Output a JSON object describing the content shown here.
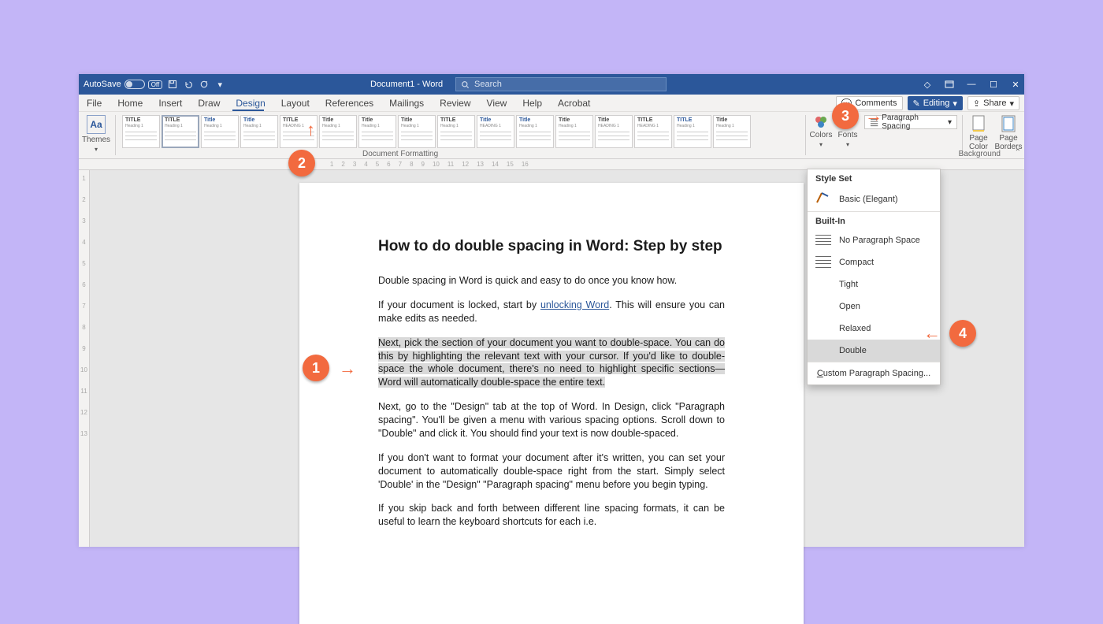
{
  "titlebar": {
    "autosave_label": "AutoSave",
    "autosave_state": "Off",
    "doc_title": "Document1 - Word",
    "search_placeholder": "Search"
  },
  "tabs": {
    "items": [
      "File",
      "Home",
      "Insert",
      "Draw",
      "Design",
      "Layout",
      "References",
      "Mailings",
      "Review",
      "View",
      "Help",
      "Acrobat"
    ],
    "active_index": 4,
    "right": {
      "comments": "Comments",
      "editing": "Editing",
      "share": "Share"
    }
  },
  "ribbon": {
    "themes": "Themes",
    "gallery_titles": [
      "TITLE",
      "TITLE",
      "Title",
      "Title",
      "TITLE",
      "Title",
      "Title",
      "Title",
      "TITLE",
      "Title",
      "Title",
      "Title",
      "Title",
      "TITLE",
      "TITLE",
      "Title"
    ],
    "gallery_headings": [
      "Heading 1",
      "Heading 1",
      "Heading 1",
      "Heading 1",
      "HEADING 1",
      "Heading 1",
      "Heading 1",
      "Heading 1",
      "Heading 1",
      "HEADING 1",
      "Heading 1",
      "Heading 1",
      "HEADING 1",
      "HEADING 1",
      "Heading 1",
      "Heading 1"
    ],
    "group_label": "Document Formatting",
    "colors": "Colors",
    "fonts": "Fonts",
    "paragraph_spacing": "Paragraph Spacing",
    "page_color": "Page\nColor",
    "page_borders": "Page\nBorders",
    "background_label": "Background"
  },
  "psmenu": {
    "style_set": "Style Set",
    "basic_elegant": "Basic (Elegant)",
    "built_in": "Built-In",
    "options": [
      "No Paragraph Space",
      "Compact",
      "Tight",
      "Open",
      "Relaxed",
      "Double"
    ],
    "selected_index": 5,
    "custom": "Custom Paragraph Spacing..."
  },
  "doc": {
    "heading": "How to do double spacing in Word: Step by step",
    "p1": "Double spacing in Word is quick and easy to do once you know how.",
    "p2a": "If your document is locked, start by ",
    "p2link": "unlocking Word",
    "p2b": ". This will ensure you can make edits as needed.",
    "p3": "Next, pick the section of your document you want to double-space. You can do this by highlighting the relevant text with your cursor. If you'd like to double-space the whole document, there's no need to highlight specific sections—Word will automatically double-space the entire text.",
    "p4": "Next, go to the \"Design\" tab at the top of Word. In Design, click \"Paragraph spacing\". You'll be given a menu with various spacing options. Scroll down to \"Double\" and click it. You should find your text is now double-spaced.",
    "p5": "If you don't want to format your document after it's written, you can set your document to automatically double-space right from the start. Simply select 'Double' in the \"Design\" \"Paragraph spacing\" menu before you begin typing.",
    "p6": "If you skip back and forth between different line spacing formats, it can be useful to learn the keyboard shortcuts for each i.e."
  },
  "annotations": {
    "b1": "1",
    "b2": "2",
    "b3": "3",
    "b4": "4"
  }
}
